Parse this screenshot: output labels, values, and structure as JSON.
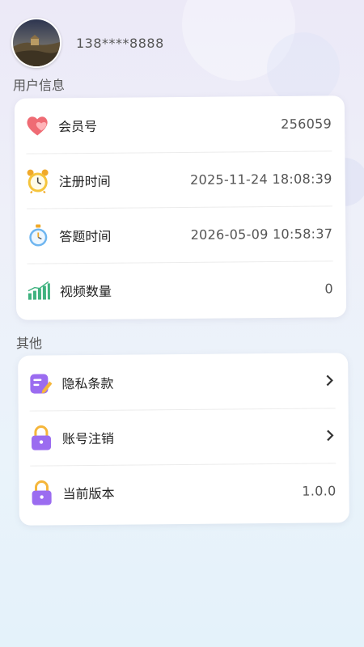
{
  "user": {
    "phone": "138****8888"
  },
  "sections": {
    "user_info": "用户信息",
    "other": "其他"
  },
  "user_info_rows": [
    {
      "label": "会员号",
      "value": "256059",
      "icon": "heart-icon"
    },
    {
      "label": "注册时间",
      "value": "2025-11-24 18:08:39",
      "icon": "alarm-clock-icon"
    },
    {
      "label": "答题时间",
      "value": "2026-05-09 10:58:37",
      "icon": "stopwatch-icon"
    },
    {
      "label": "视频数量",
      "value": "0",
      "icon": "bar-chart-icon"
    }
  ],
  "other_rows": [
    {
      "label": "隐私条款",
      "icon": "document-pen-icon"
    },
    {
      "label": "账号注销",
      "icon": "lock-icon"
    },
    {
      "label": "当前版本",
      "value": "1.0.0",
      "icon": "lock-icon"
    }
  ],
  "colors": {
    "accent_purple": "#9b6cf0",
    "heart": "#f0707a",
    "gold": "#f2b531",
    "green": "#3fb27f"
  }
}
